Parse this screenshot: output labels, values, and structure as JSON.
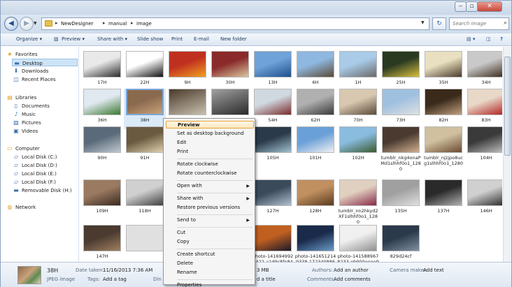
{
  "window": {
    "minimize": "‒",
    "maximize": "▫",
    "close": "✕"
  },
  "address": {
    "crumbs": [
      "NewDesigner",
      "manual",
      "image"
    ],
    "search_placeholder": "Search image"
  },
  "toolbar": {
    "organize": "Organize ▾",
    "preview": "Preview ▾",
    "share": "Share with ▾",
    "slideshow": "Slide show",
    "print": "Print",
    "email": "E-mail",
    "newfolder": "New folder"
  },
  "nav": [
    {
      "label": "Favorites",
      "icon": "★",
      "kind": "header"
    },
    {
      "label": "Desktop",
      "icon": "▬",
      "kind": "sub",
      "selected": true
    },
    {
      "label": "Downloads",
      "icon": "⬇",
      "kind": "sub"
    },
    {
      "label": "Recent Places",
      "icon": "◫",
      "kind": "sub"
    },
    {
      "label": "Libraries",
      "icon": "▤",
      "kind": "header"
    },
    {
      "label": "Documents",
      "icon": "▯",
      "kind": "sub"
    },
    {
      "label": "Music",
      "icon": "♪",
      "kind": "sub"
    },
    {
      "label": "Pictures",
      "icon": "▨",
      "kind": "sub"
    },
    {
      "label": "Videos",
      "icon": "▣",
      "kind": "sub"
    },
    {
      "label": "Computer",
      "icon": "▭",
      "kind": "header"
    },
    {
      "label": "Local Disk (C:)",
      "icon": "▱",
      "kind": "sub"
    },
    {
      "label": "Local Disk (D:)",
      "icon": "▱",
      "kind": "sub"
    },
    {
      "label": "Local Disk (E:)",
      "icon": "▱",
      "kind": "sub"
    },
    {
      "label": "Local Disk (F:)",
      "icon": "▱",
      "kind": "sub"
    },
    {
      "label": "Removable Disk (H:)",
      "icon": "▬",
      "kind": "sub"
    },
    {
      "label": "Network",
      "icon": "◍",
      "kind": "header"
    }
  ],
  "files": [
    {
      "label": "17H",
      "c1": "#e9e9e9",
      "c2": "#2b2b2b"
    },
    {
      "label": "22H",
      "c1": "#ffffff",
      "c2": "#111111"
    },
    {
      "label": "9H",
      "c1": "#c0301f",
      "c2": "#f0a020"
    },
    {
      "label": "30H",
      "c1": "#8a2a2a",
      "c2": "#d9c7a0"
    },
    {
      "label": "13H",
      "c1": "#6fa2d8",
      "c2": "#1d4f8d"
    },
    {
      "label": "6H",
      "c1": "#8fb8e0",
      "c2": "#5a4a36"
    },
    {
      "label": "1H",
      "c1": "#a9cbe8",
      "c2": "#6a6a6a"
    },
    {
      "label": "25H",
      "c1": "#2a3a20",
      "c2": "#d8c040"
    },
    {
      "label": "35H",
      "c1": "#e8e0c0",
      "c2": "#4a3a2a"
    },
    {
      "label": "34H",
      "c1": "#c9c9c9",
      "c2": "#3a2a1a"
    },
    {
      "label": "36H",
      "c1": "#e0e8f0",
      "c2": "#3a7a30"
    },
    {
      "label": "38H",
      "c1": "#8a6a4e",
      "c2": "#c9a27a",
      "selected": true
    },
    {
      "label": "",
      "c1": "#4a3a2a",
      "c2": "#c8c0b0"
    },
    {
      "label": "",
      "c1": "#a0a0a0",
      "c2": "#2a2a2a"
    },
    {
      "label": "54H",
      "c1": "#d0d8e0",
      "c2": "#7a2a2a"
    },
    {
      "label": "62H",
      "c1": "#b0b0b0",
      "c2": "#3a3a3a"
    },
    {
      "label": "70H",
      "c1": "#d8c8b0",
      "c2": "#5a4a3a"
    },
    {
      "label": "73H",
      "c1": "#a0c0e0",
      "c2": "#e0e0e0"
    },
    {
      "label": "82H",
      "c1": "#3a2a1a",
      "c2": "#c0a080"
    },
    {
      "label": "83H",
      "c1": "#e8d8c8",
      "c2": "#b02020"
    },
    {
      "label": "90H",
      "c1": "#5a6a7a",
      "c2": "#c0c8d0"
    },
    {
      "label": "91H",
      "c1": "#6a5a40",
      "c2": "#e0d0b0"
    },
    {
      "label": "",
      "c1": "#e0e0e0",
      "c2": "#e0e0e0"
    },
    {
      "label": "",
      "c1": "#c0c8d0",
      "c2": "#505050"
    },
    {
      "label": "105H",
      "c1": "#2a3a4a",
      "c2": "#a0c0d0"
    },
    {
      "label": "101H",
      "c1": "#6aa0d8",
      "c2": "#f0f0f0"
    },
    {
      "label": "102H",
      "c1": "#8abce0",
      "c2": "#3a5a30"
    },
    {
      "label": "tumblr_nkg4onaPMd1slhhf0o1_1280",
      "c1": "#4a3a30",
      "c2": "#d0b090"
    },
    {
      "label": "tumblr_njzjpo8ucg1slhhf0o1_1280",
      "c1": "#d0c0a0",
      "c2": "#6a4a30"
    },
    {
      "label": "104H",
      "c1": "#3a3a3a",
      "c2": "#c0c0c0"
    },
    {
      "label": "109H",
      "c1": "#9a7a60",
      "c2": "#3a2a20"
    },
    {
      "label": "118H",
      "c1": "#d0d0d0",
      "c2": "#404040"
    },
    {
      "label": "",
      "c1": "#e0e0e0",
      "c2": "#e0e0e0"
    },
    {
      "label": "tumblr_nm4rfdPyx1slhhf0o1_1280",
      "c1": "#6a6a6a",
      "c2": "#d0d0d0"
    },
    {
      "label": "127H",
      "c1": "#3a4a5a",
      "c2": "#b0c0d0"
    },
    {
      "label": "128H",
      "c1": "#c09060",
      "c2": "#5a3a20"
    },
    {
      "label": "tumblr_nn2hkyd2XF1slhhf0o1_1280",
      "c1": "#e0d0c0",
      "c2": "#8a2a4a"
    },
    {
      "label": "135H",
      "c1": "#a0a0a0",
      "c2": "#e0e0e0"
    },
    {
      "label": "137H",
      "c1": "#2a2a2a",
      "c2": "#b0b0b0"
    },
    {
      "label": "146H",
      "c1": "#d0d0d0",
      "c2": "#2a2a2a"
    },
    {
      "label": "147H",
      "c1": "#4a3a30",
      "c2": "#a08060"
    },
    {
      "label": "",
      "c1": "#e0e0e0",
      "c2": "#e0e0e0"
    },
    {
      "label": "158H",
      "c1": "#c8d8e8",
      "c2": "#404a50"
    },
    {
      "label": "159H",
      "c1": "#7a5a50",
      "c2": "#d0b0a0"
    },
    {
      "label": "photo-1416949929422-a1d9c8fe84",
      "c1": "#c06020",
      "c2": "#1a1a2a"
    },
    {
      "label": "photo-1416512149338-1723408867",
      "c1": "#1a2a4a",
      "c2": "#6a9ac8"
    },
    {
      "label": "photo-1415889678233-eb900eeee9",
      "c1": "#f0f0f0",
      "c2": "#909090"
    },
    {
      "label": "829d24cf",
      "c1": "#2a3a4a",
      "c2": "#8090a0"
    }
  ],
  "context_menu": {
    "items": [
      {
        "label": "Preview",
        "highlight": true
      },
      {
        "label": "Set as desktop background"
      },
      {
        "label": "Edit"
      },
      {
        "label": "Print"
      },
      {
        "sep": true
      },
      {
        "label": "Rotate clockwise"
      },
      {
        "label": "Rotate counterclockwise"
      },
      {
        "sep": true
      },
      {
        "label": "Open with",
        "submenu": true
      },
      {
        "sep": true
      },
      {
        "label": "Share with",
        "submenu": true
      },
      {
        "label": "Restore previous versions"
      },
      {
        "sep": true
      },
      {
        "label": "Send to",
        "submenu": true
      },
      {
        "sep": true
      },
      {
        "label": "Cut"
      },
      {
        "label": "Copy"
      },
      {
        "sep": true
      },
      {
        "label": "Create shortcut"
      },
      {
        "label": "Delete"
      },
      {
        "label": "Rename"
      },
      {
        "sep": true
      },
      {
        "label": "Properties"
      }
    ]
  },
  "details": {
    "name": "38H",
    "type": "JPEG image",
    "date_label": "Date taken:",
    "date_value": "11/16/2013 7:36 AM",
    "tags_label": "Tags:",
    "tags_value": "Add a tag",
    "dim_label": "Din",
    "size_value": "3 MB",
    "title_value": "d a title",
    "authors_label": "Authors:",
    "authors_value": "Add an author",
    "comments_label": "Comments:",
    "comments_value": "Add comments",
    "camera_label": "Camera maker:",
    "camera_value": "Add text"
  }
}
